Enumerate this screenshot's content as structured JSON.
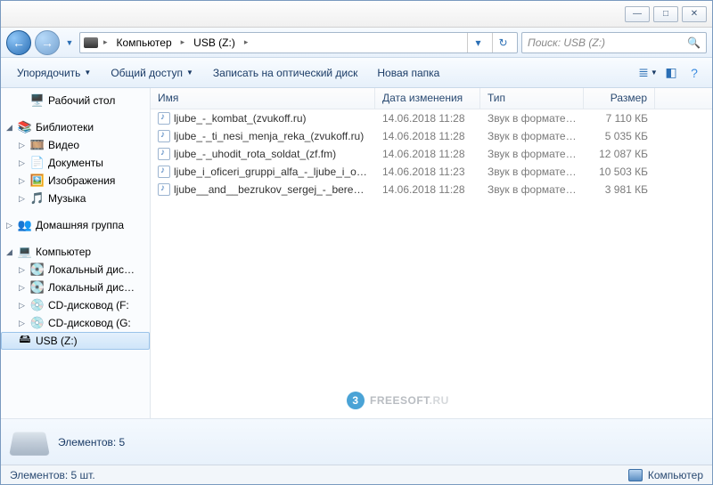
{
  "titlebar": {
    "min": "—",
    "max": "□",
    "close": "✕"
  },
  "nav": {
    "breadcrumb": [
      {
        "label": "Компьютер"
      },
      {
        "label": "USB (Z:)"
      }
    ],
    "search_placeholder": "Поиск: USB (Z:)"
  },
  "toolbar": {
    "organize": "Упорядочить",
    "share": "Общий доступ",
    "burn": "Записать на оптический диск",
    "newfolder": "Новая папка"
  },
  "sidebar": {
    "desktop": "Рабочий стол",
    "libraries": {
      "label": "Библиотеки",
      "video": "Видео",
      "documents": "Документы",
      "pictures": "Изображения",
      "music": "Музыка"
    },
    "homegroup": "Домашняя группа",
    "computer": {
      "label": "Компьютер",
      "local": "Локальный дис…",
      "local2": "Локальный дис…",
      "cdF": "CD-дисковод (F:",
      "cdG": "CD-дисковод (G:",
      "usb": "USB (Z:)"
    }
  },
  "columns": {
    "name": "Имя",
    "date": "Дата изменения",
    "type": "Тип",
    "size": "Размер"
  },
  "files": [
    {
      "name": "ljube_-_kombat_(zvukoff.ru)",
      "date": "14.06.2018 11:28",
      "type": "Звук в формате ...",
      "size": "7 110 КБ"
    },
    {
      "name": "ljube_-_ti_nesi_menja_reka_(zvukoff.ru)",
      "date": "14.06.2018 11:28",
      "type": "Звук в формате ...",
      "size": "5 035 КБ"
    },
    {
      "name": "ljube_-_uhodit_rota_soldat_(zf.fm)",
      "date": "14.06.2018 11:28",
      "type": "Звук в формате ...",
      "size": "12 087 КБ"
    },
    {
      "name": "ljube_i_oficeri_gruppi_alfa_-_ljube_i_ofice...",
      "date": "14.06.2018 11:23",
      "type": "Звук в формате ...",
      "size": "10 503 КБ"
    },
    {
      "name": "ljube__and__bezrukov_sergej_-_berezi_(zv...",
      "date": "14.06.2018 11:28",
      "type": "Звук в формате ...",
      "size": "3 981 КБ"
    }
  ],
  "watermark": {
    "brand": "FREESOFT",
    "tld": ".RU",
    "badge": "3"
  },
  "details": {
    "summary": "Элементов: 5"
  },
  "status": {
    "left": "Элементов: 5 шт.",
    "right": "Компьютер"
  }
}
